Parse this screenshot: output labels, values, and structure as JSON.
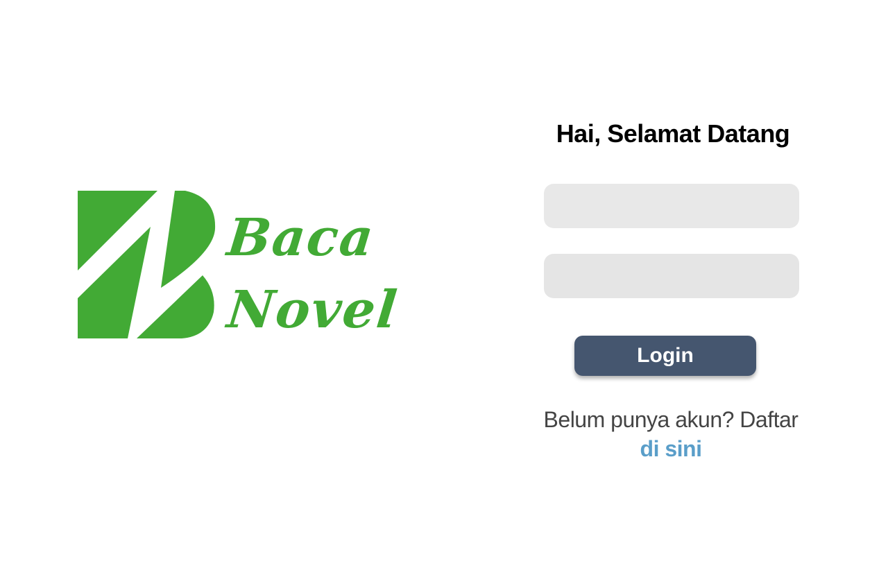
{
  "brand": {
    "line1": "Baca",
    "line2": "Novel",
    "color": "#42aa35"
  },
  "login": {
    "greeting": "Hai, Selamat Datang",
    "username_placeholder": "",
    "password_placeholder": "",
    "submit_label": "Login",
    "button_color": "#45566f"
  },
  "register": {
    "prompt": "Belum punya akun?  Daftar",
    "link_label": "di sini",
    "link_color": "#5a9ec9"
  }
}
